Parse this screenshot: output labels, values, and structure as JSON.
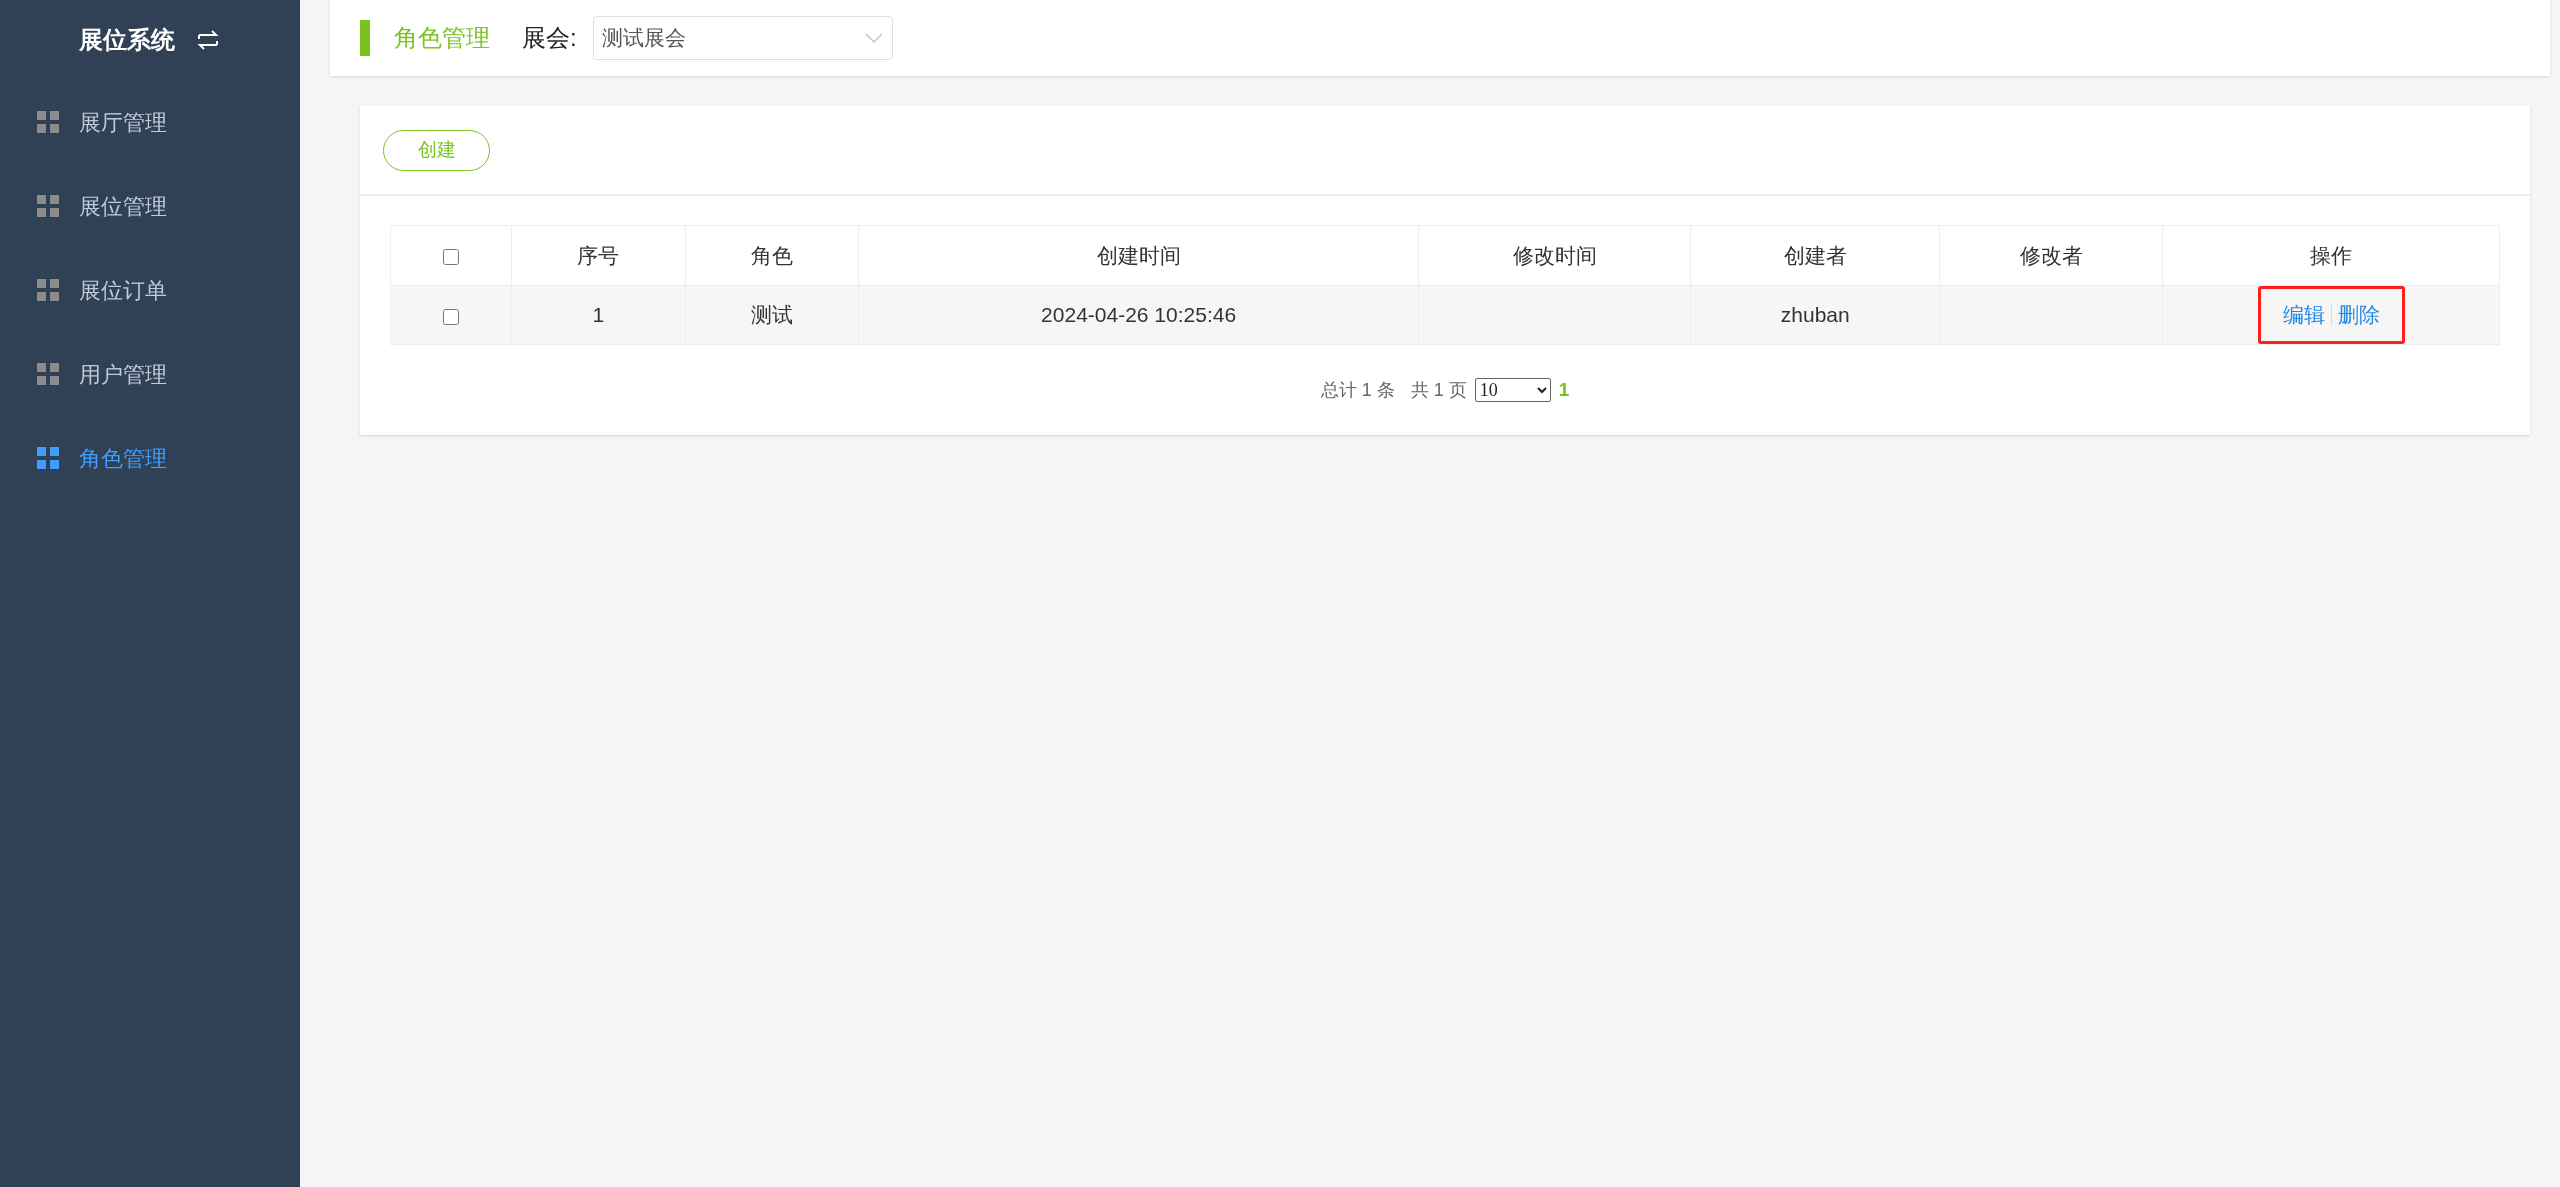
{
  "sidebar": {
    "title": "展位系统",
    "items": [
      {
        "label": "展厅管理",
        "selected": false
      },
      {
        "label": "展位管理",
        "selected": false
      },
      {
        "label": "展位订单",
        "selected": false
      },
      {
        "label": "用户管理",
        "selected": false
      },
      {
        "label": "角色管理",
        "selected": true
      }
    ]
  },
  "header": {
    "page_title": "角色管理",
    "exhibition_label": "展会:",
    "exhibition_value": "测试展会"
  },
  "toolbar": {
    "create_button": "创建"
  },
  "table": {
    "select_all_checked": false,
    "columns": [
      "序号",
      "角色",
      "创建时间",
      "修改时间",
      "创建者",
      "修改者",
      "操作"
    ],
    "rows": [
      {
        "checked": false,
        "highlighted": true,
        "cells": [
          "1",
          "测试",
          "2024-04-26 10:25:46",
          "",
          "zhuban",
          ""
        ],
        "actions": [
          "编辑",
          "删除"
        ]
      }
    ]
  },
  "pagination": {
    "total": "总计 1 条",
    "pages": "共 1 页",
    "page_size": "10",
    "pages_list": [
      {
        "label": "1",
        "selected": true
      }
    ]
  }
}
